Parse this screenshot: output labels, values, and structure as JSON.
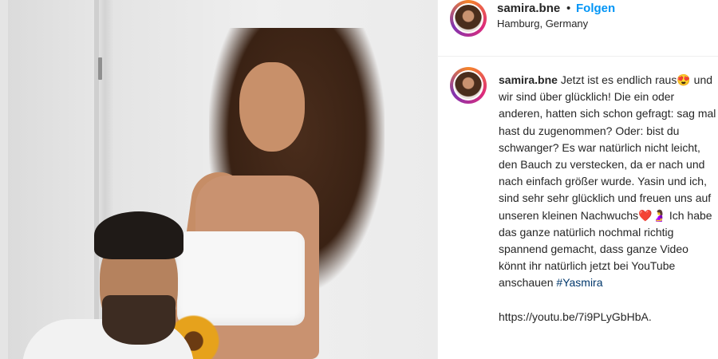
{
  "post": {
    "username": "samira.bne",
    "separator": "•",
    "follow_label": "Folgen",
    "location": "Hamburg, Germany",
    "caption": {
      "username": "samira.bne",
      "text": "Jetzt ist es endlich raus😍 und wir sind über glücklich! Die ein oder anderen, hatten sich schon gefragt: sag mal hast du zugenommen? Oder: bist du schwanger? Es war natürlich nicht leicht, den Bauch zu verstecken, da er nach und nach einfach größer wurde. Yasin und ich, sind sehr sehr glücklich und freuen uns auf unseren kleinen Nachwuchs❤️🤰 Ich habe das ganze natürlich nochmal richtig spannend gemacht, dass ganze Video könnt ihr natürlich jetzt bei YouTube anschauen",
      "hashtag": "#Yasmira",
      "link": "https://youtu.be/7i9PLyGbHbA."
    }
  },
  "colors": {
    "accent": "#0095f6",
    "hashtag": "#00376b",
    "text": "#262626"
  }
}
